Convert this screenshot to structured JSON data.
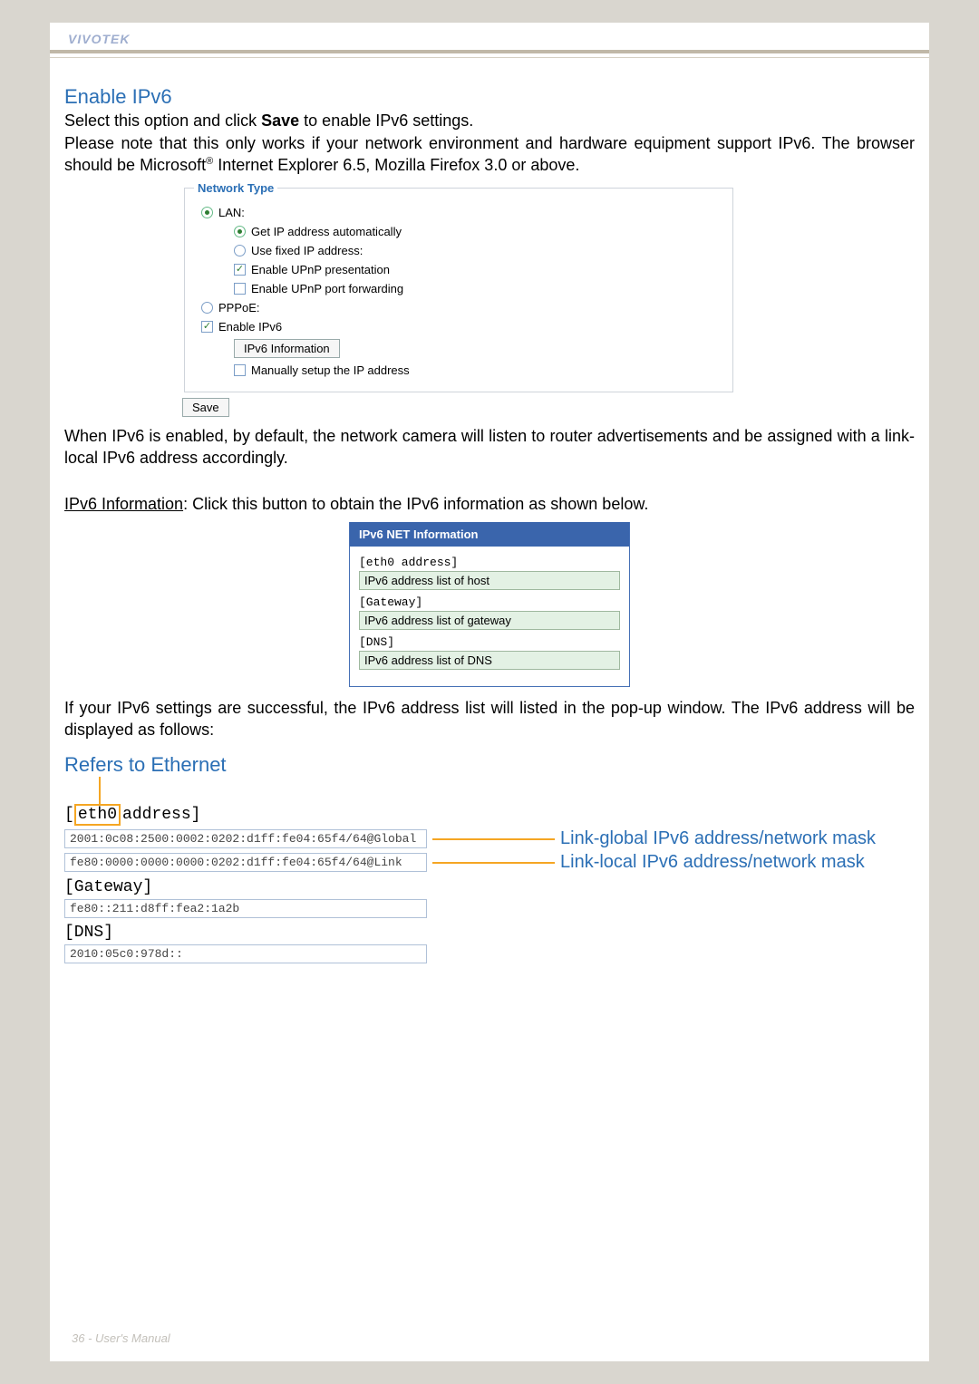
{
  "brand": "VIVOTEK",
  "section": {
    "title": "Enable IPv6",
    "line1_a": "Select this option and click ",
    "line1_b": "Save",
    "line1_c": " to enable IPv6 settings.",
    "line2_a": "Please note that this only works if your network environment and hardware equipment support IPv6. The browser should be Microsoft",
    "line2_sup": "®",
    "line2_b": " Internet Explorer 6.5, Mozilla Firefox 3.0 or above."
  },
  "panel": {
    "legend": "Network Type",
    "lan": "LAN:",
    "get_ip": "Get IP address automatically",
    "fixed_ip": "Use fixed IP address:",
    "upnp_present": "Enable UPnP presentation",
    "upnp_port": "Enable UPnP port forwarding",
    "pppoe": "PPPoE:",
    "enable_ipv6": "Enable IPv6",
    "ipv6_info_btn": "IPv6 Information",
    "manual_ip": "Manually setup the IP address",
    "save": "Save"
  },
  "after_panel": "When IPv6 is enabled, by default, the network camera will listen to router advertisements and be assigned with a link-local IPv6 address accordingly.",
  "ipv6_info_line_a": "IPv6 Information",
  "ipv6_info_line_b": ": Click this button to obtain the IPv6 information as shown below.",
  "popup": {
    "title": "IPv6 NET Information",
    "eth0": "[eth0 address]",
    "host_list": "IPv6 address list of host",
    "gateway": "[Gateway]",
    "gw_list": "IPv6 address list of gateway",
    "dns": "[DNS]",
    "dns_list": "IPv6 address list of DNS"
  },
  "success_text": "If your IPv6 settings are successful, the IPv6 address list will listed in the pop-up window. The IPv6 address will be displayed as follows:",
  "refers": {
    "title": "Refers to Ethernet",
    "eth0_box": "eth0",
    "eth0_bracket_l": "[",
    "eth0_rest": "address]",
    "global_addr": "2001:0c08:2500:0002:0202:d1ff:fe04:65f4/64@Global",
    "global_label": "Link-global IPv6 address/network mask",
    "link_addr": "fe80:0000:0000:0000:0202:d1ff:fe04:65f4/64@Link",
    "link_label": "Link-local IPv6 address/network mask",
    "gateway_label": "[Gateway]",
    "gateway_val": "fe80::211:d8ff:fea2:1a2b",
    "dns_label": "[DNS]",
    "dns_val": "2010:05c0:978d::"
  },
  "footer": "36 - User's Manual"
}
